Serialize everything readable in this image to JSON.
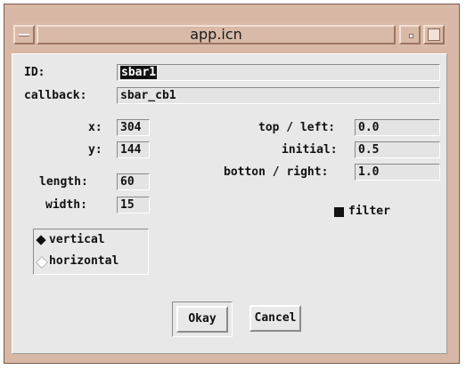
{
  "window": {
    "title": "app.icn"
  },
  "form": {
    "id_label": "ID:",
    "id_value": "sbar1",
    "callback_label": "callback:",
    "callback_value": "sbar_cb1",
    "x_label": "x:",
    "x_value": "304",
    "y_label": "y:",
    "y_value": "144",
    "length_label": "length:",
    "length_value": "60",
    "width_label": "width:",
    "width_value": "15",
    "top_left_label": "top / left:",
    "top_left_value": "0.0",
    "initial_label": "initial:",
    "initial_value": "0.5",
    "bottom_right_label": "botton / right:",
    "bottom_right_value": "1.0",
    "filter_label": "filter",
    "filter_checked": true,
    "orientation": {
      "options": [
        "vertical",
        "horizontal"
      ],
      "selected": "vertical"
    }
  },
  "buttons": {
    "okay": "Okay",
    "cancel": "Cancel"
  }
}
